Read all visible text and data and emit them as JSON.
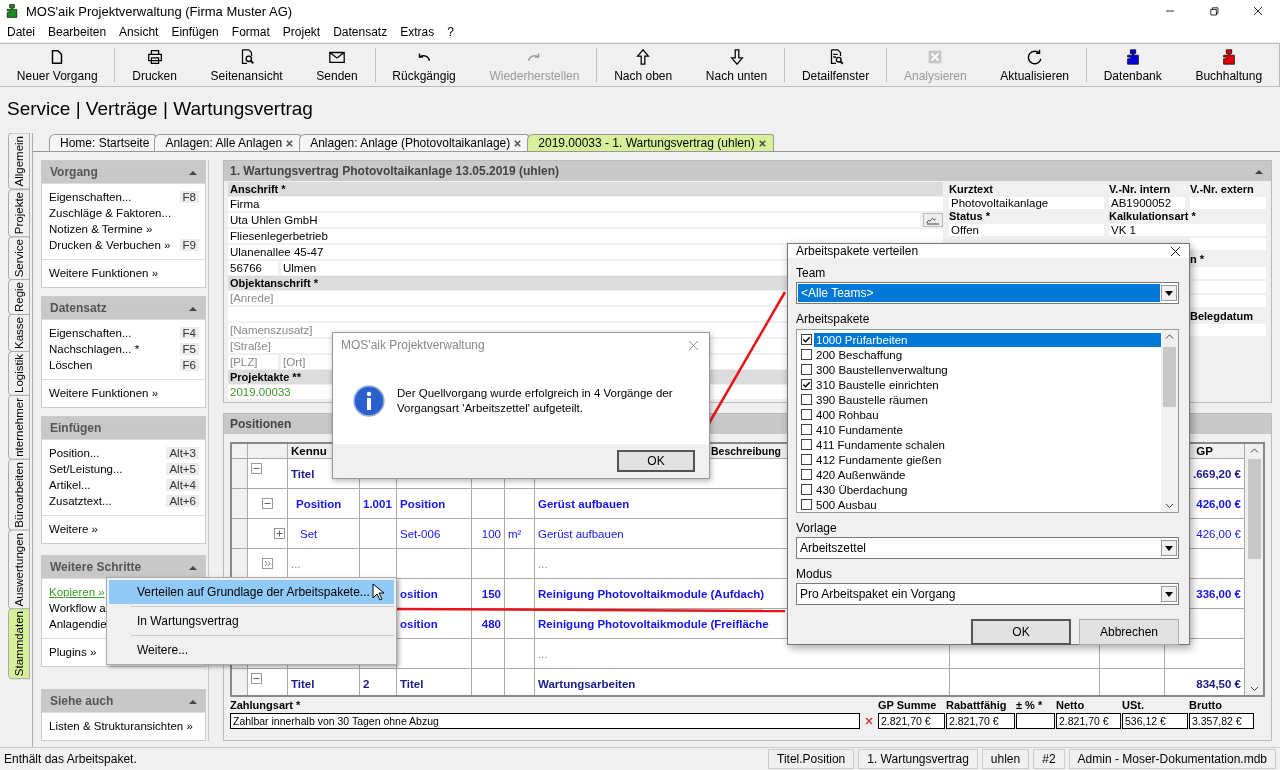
{
  "window": {
    "title": "MOS'aik Projektverwaltung (Firma Muster AG)"
  },
  "menu": [
    "Datei",
    "Bearbeiten",
    "Ansicht",
    "Einfügen",
    "Format",
    "Projekt",
    "Datensatz",
    "Extras",
    "?"
  ],
  "toolbar": [
    {
      "kind": "button",
      "label": "Neuer Vorgang",
      "disabled": false
    },
    {
      "kind": "separator"
    },
    {
      "kind": "button",
      "label": "Drucken",
      "disabled": false
    },
    {
      "kind": "button",
      "label": "Seitenansicht",
      "disabled": false
    },
    {
      "kind": "button",
      "label": "Senden",
      "disabled": false
    },
    {
      "kind": "separator"
    },
    {
      "kind": "button",
      "label": "Rückgängig",
      "disabled": false
    },
    {
      "kind": "button",
      "label": "Wiederherstellen",
      "disabled": true
    },
    {
      "kind": "separator"
    },
    {
      "kind": "button",
      "label": "Nach oben",
      "disabled": false
    },
    {
      "kind": "button",
      "label": "Nach unten",
      "disabled": false
    },
    {
      "kind": "separator"
    },
    {
      "kind": "button",
      "label": "Detailfenster",
      "disabled": false
    },
    {
      "kind": "separator"
    },
    {
      "kind": "button",
      "label": "Analysieren",
      "disabled": true
    },
    {
      "kind": "button",
      "label": "Aktualisieren",
      "disabled": false
    },
    {
      "kind": "separator"
    },
    {
      "kind": "button",
      "label": "Datenbank",
      "disabled": false
    },
    {
      "kind": "button",
      "label": "Buchhaltung",
      "disabled": false
    }
  ],
  "breadcrumb": "Service | Verträge | Wartungsvertrag",
  "side_tabs": [
    {
      "label": "Allgemein",
      "selected": false
    },
    {
      "label": "Projekte",
      "selected": false
    },
    {
      "label": "Service",
      "selected": false
    },
    {
      "label": "Regie",
      "selected": false
    },
    {
      "label": "Kasse",
      "selected": false
    },
    {
      "label": "Logistik",
      "selected": false
    },
    {
      "label": "nternehmer",
      "selected": false
    },
    {
      "label": "Büroarbeiten",
      "selected": false
    },
    {
      "label": "Auswertungen",
      "selected": false
    },
    {
      "label": "Stammdaten",
      "selected": true
    }
  ],
  "doc_tabs": [
    {
      "label": "Home: Startseite",
      "closable": false,
      "selected": false
    },
    {
      "label": "Anlagen: Alle Anlagen",
      "closable": true,
      "selected": false
    },
    {
      "label": "Anlagen: Anlage (Photovoltaikanlage)",
      "closable": true,
      "selected": false
    },
    {
      "label": "2019.00033 - 1. Wartungsvertrag (uhlen)",
      "closable": true,
      "selected": true
    }
  ],
  "sidebar": [
    {
      "title": "Vorgang",
      "collapsible": true,
      "groups": [
        [
          {
            "label": "Eigenschaften...",
            "shortcut": "F8"
          },
          {
            "label": "Zuschläge & Faktoren..."
          },
          {
            "label": "Notizen & Termine »"
          },
          {
            "label": "Drucken & Verbuchen »",
            "shortcut": "F9"
          }
        ],
        [
          {
            "label": "Weitere Funktionen »"
          }
        ]
      ]
    },
    {
      "title": "Datensatz",
      "collapsible": true,
      "groups": [
        [
          {
            "label": "Eigenschaften...",
            "shortcut": "F4"
          },
          {
            "label": "Nachschlagen... *",
            "shortcut": "F5"
          },
          {
            "label": "Löschen",
            "shortcut": "F6"
          }
        ],
        [
          {
            "label": "Weitere Funktionen »"
          }
        ]
      ]
    },
    {
      "title": "Einfügen",
      "collapsible": false,
      "groups": [
        [
          {
            "label": "Position...",
            "shortcut": "Alt+3"
          },
          {
            "label": "Set/Leistung...",
            "shortcut": "Alt+5"
          },
          {
            "label": "Artikel...",
            "shortcut": "Alt+4"
          },
          {
            "label": "Zusatztext...",
            "shortcut": "Alt+6"
          }
        ],
        [
          {
            "label": "Weitere »"
          }
        ]
      ]
    },
    {
      "title": "Weitere Schritte",
      "collapsible": true,
      "groups": [
        [
          {
            "label": "Kopieren »",
            "kind": "link"
          },
          {
            "label": "Workflow a"
          },
          {
            "label": "Anlagendie"
          }
        ],
        [
          {
            "label": "Plugins »"
          }
        ]
      ]
    },
    {
      "title": "Siehe auch",
      "collapsible": true,
      "groups": [
        [
          {
            "label": "Listen & Strukturansichten »"
          }
        ]
      ]
    }
  ],
  "form": {
    "title": "1. Wartungsvertrag Photovoltaikanlage 13.05.2019 (uhlen)",
    "address": {
      "label": "Anschrift *",
      "lines": [
        "Firma",
        "Uta Uhlen GmbH",
        "Fliesenlegerbetrieb",
        "Ulanenallee 45-47"
      ],
      "zip": "56766",
      "city": "Ulmen"
    },
    "object_address": {
      "label": "Objektanschrift *",
      "lines": [
        {
          "kind": "field",
          "placeholder": "[Anrede]"
        },
        {
          "kind": "field"
        },
        {
          "kind": "field",
          "placeholder": "[Namenszusatz]"
        },
        {
          "kind": "field",
          "placeholder": "[Straße]"
        }
      ],
      "zip_placeholder": "[PLZ]",
      "city_placeholder": "[Ort]"
    },
    "project": {
      "label": "Projektakte **",
      "value": "2019.00033"
    },
    "info": [
      {
        "label": "Kurztext",
        "value": "Photovoltaikanlage"
      },
      {
        "label": "V.-Nr. intern",
        "value": "AB1900052"
      },
      {
        "label": "V.-Nr. extern"
      },
      {
        "label": "Status *",
        "value": "Offen"
      },
      {
        "label": "Kalkulationsart *",
        "value": "VK 1",
        "wide": true
      }
    ],
    "more": [
      {
        "kind": "field"
      },
      {
        "kind": "field",
        "label": "n *"
      },
      {
        "kind": "field"
      },
      {
        "kind": "field"
      },
      {
        "kind": "field",
        "label": "Belegdatum"
      }
    ]
  },
  "positions": {
    "title": "Positionen",
    "headers": {
      "kennung": "Kennu",
      "beschreibung": "Beschreibung",
      "gp": "GP"
    },
    "rows": [
      {
        "kind": "title",
        "toggle": true,
        "expanded": true,
        "kennung": "Titel",
        "gp": ".669,20 €"
      },
      {
        "kind": "position",
        "toggle": true,
        "expanded": true,
        "kennung": "Position",
        "nr": "1.001",
        "column_5": "Position",
        "beschreibung": "Gerüst aufbauen",
        "gp": "426,00 €"
      },
      {
        "kind": "set",
        "toggle": true,
        "expanded": false,
        "kennung": "Set",
        "column_5": "Set-006",
        "menge": "100",
        "einheit": "m²",
        "beschreibung": "Gerüst aufbauen",
        "gp": "426,00 €"
      },
      {
        "kind": "ellipsis",
        "toggle": true,
        "kennung": "...",
        "beschreibung": "..."
      },
      {
        "kind": "position",
        "column_5": "osition",
        "menge": "150",
        "beschreibung": "Reinigung Photovoltaikmodule (Aufdach)",
        "gp": "336,00 €"
      },
      {
        "kind": "position",
        "column_5": "osition",
        "menge": "480",
        "beschreibung": "Reinigung Photovoltaikmodule (Freifläche"
      },
      {
        "kind": "ellipsis",
        "beschreibung": "..."
      },
      {
        "kind": "title",
        "toggle": true,
        "expanded": true,
        "kennung": "Titel",
        "nr": "2",
        "column_5": "Titel",
        "beschreibung": "Wartungsarbeiten",
        "gp": "834,50 €"
      }
    ]
  },
  "totals": {
    "payment_label": "Zahlungsart *",
    "payment_value": "Zahlbar innerhalb von 30 Tagen ohne Abzug",
    "columns": [
      {
        "label": "GP Summe",
        "value": "2.821,70 €"
      },
      {
        "label": "Rabattfähig",
        "value": "2.821,70 €"
      },
      {
        "label": "± % *"
      },
      {
        "label": "Netto",
        "value": "2.821,70 €"
      },
      {
        "label": "USt.",
        "value": "536,12 €"
      },
      {
        "label": "Brutto",
        "value": "3.357,82 €"
      }
    ]
  },
  "status_bar": {
    "message": "Enthält das Arbeitspaket.",
    "panels": [
      "Titel.Position",
      "1. Wartungsvertrag",
      "uhlen",
      "#2",
      "Admin - Moser-Dokumentation.mdb"
    ]
  },
  "message_box": {
    "title": "MOS'aik Projektverwaltung",
    "active": false,
    "text": "Der Quellvorgang wurde erfolgreich in 4 Vorgänge der Vorgangsart 'Arbeitszettel' aufgeteilt.",
    "button": "OK"
  },
  "dialog": {
    "title": "Arbeitspakete verteilen",
    "team_label": "Team",
    "team_value": "<Alle Teams>",
    "packages_label": "Arbeitspakete",
    "packages": [
      {
        "label": "1000 Prüfarbeiten",
        "checked": true,
        "selected": true
      },
      {
        "label": "200 Beschaffung",
        "checked": false,
        "selected": false
      },
      {
        "label": "300 Baustellenverwaltung",
        "checked": false,
        "selected": false
      },
      {
        "label": "310 Baustelle einrichten",
        "checked": true,
        "selected": false
      },
      {
        "label": "390 Baustelle räumen",
        "checked": false,
        "selected": false
      },
      {
        "label": "400 Rohbau",
        "checked": false,
        "selected": false
      },
      {
        "label": "410 Fundamente",
        "checked": false,
        "selected": false
      },
      {
        "label": "411 Fundamente schalen",
        "checked": false,
        "selected": false
      },
      {
        "label": "412 Fundamente gießen",
        "checked": false,
        "selected": false
      },
      {
        "label": "420 Außenwände",
        "checked": false,
        "selected": false
      },
      {
        "label": "430 Überdachung",
        "checked": false,
        "selected": false
      },
      {
        "label": "500 Ausbau",
        "checked": false,
        "selected": false
      }
    ],
    "template_label": "Vorlage",
    "template_value": "Arbeitszettel",
    "mode_label": "Modus",
    "mode_value": "Pro Arbeitspaket ein Vorgang",
    "ok": "OK",
    "cancel": "Abbrechen"
  },
  "context_menu": {
    "items": [
      {
        "label": "Verteilen auf Grundlage der Arbeitspakete...",
        "selected": true
      },
      {
        "label": "In Wartungsvertrag",
        "selected": false
      },
      {
        "label": "Weitere...",
        "selected": false
      }
    ]
  }
}
